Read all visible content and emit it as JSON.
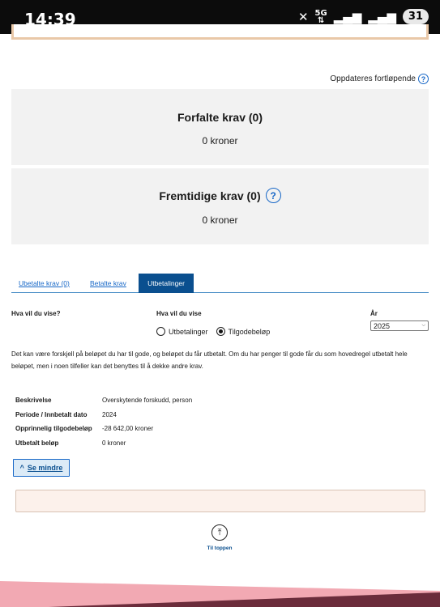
{
  "statusbar": {
    "time": "14:39",
    "network": "5G",
    "battery": "31",
    "icons": [
      "mute-icon",
      "signal-icon",
      "signal-icon"
    ]
  },
  "updated": {
    "text": "Oppdateres fortløpende",
    "help": "?"
  },
  "cards": [
    {
      "title": "Forfalte krav (0)",
      "value": "0 kroner"
    },
    {
      "title": "Fremtidige krav (0)",
      "value": "0 kroner",
      "help": "?"
    }
  ],
  "tabs": [
    {
      "label": "Ubetalte krav (0)",
      "active": false
    },
    {
      "label": "Betalte krav",
      "active": false
    },
    {
      "label": "Utbetalinger",
      "active": true
    }
  ],
  "filters": {
    "label_left": "Hva vil du vise?",
    "label_mid": "Hva vil du vise",
    "label_year": "År",
    "radio_options": [
      {
        "label": "Utbetalinger",
        "checked": false
      },
      {
        "label": "Tilgodebeløp",
        "checked": true
      }
    ],
    "year_selected": "2025"
  },
  "info_text": "Det kan være forskjell på beløpet du har til gode, og beløpet du får utbetalt. Om du har penger til gode får du som hovedregel utbetalt hele beløpet, men i noen tilfeller kan det benyttes til å dekke andre krav.",
  "details": [
    {
      "key": "Beskrivelse",
      "value": "Overskytende forskudd, person"
    },
    {
      "key": "Periode / Innbetalt dato",
      "value": "2024"
    },
    {
      "key": "Opprinnelig tilgodebeløp",
      "value": "-28 642,00 kroner"
    },
    {
      "key": "Utbetalt beløp",
      "value": "0 kroner"
    }
  ],
  "toggle": {
    "label": "Se mindre"
  },
  "to_top": {
    "label": "Til toppen"
  },
  "colors": {
    "accent": "#0a4f8f",
    "link": "#1767c7",
    "card_bg": "#f2f2f2",
    "footer_pink": "#f2a9b3",
    "footer_dark": "#6b2c3b"
  }
}
